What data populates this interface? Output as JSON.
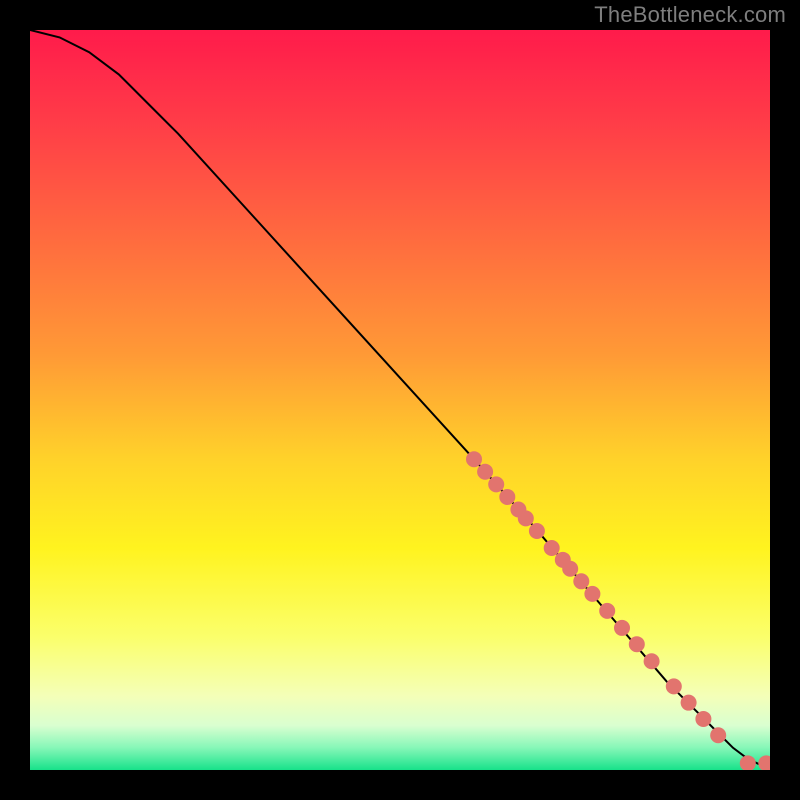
{
  "attribution": "TheBottleneck.com",
  "colors": {
    "background": "#000000",
    "curve": "#000000",
    "dot": "#e2746e",
    "gradient_stops": [
      {
        "offset": 0.0,
        "color": "#ff1b4b"
      },
      {
        "offset": 0.12,
        "color": "#ff3b48"
      },
      {
        "offset": 0.28,
        "color": "#ff6a3f"
      },
      {
        "offset": 0.44,
        "color": "#ff9a36"
      },
      {
        "offset": 0.58,
        "color": "#ffd22a"
      },
      {
        "offset": 0.7,
        "color": "#fff31f"
      },
      {
        "offset": 0.82,
        "color": "#fbff6b"
      },
      {
        "offset": 0.9,
        "color": "#f4ffb8"
      },
      {
        "offset": 0.94,
        "color": "#d9ffd0"
      },
      {
        "offset": 0.97,
        "color": "#86f7b8"
      },
      {
        "offset": 1.0,
        "color": "#18e28a"
      }
    ]
  },
  "chart_data": {
    "type": "line",
    "title": "",
    "xlabel": "",
    "ylabel": "",
    "xlim": [
      0,
      100
    ],
    "ylim": [
      0,
      100
    ],
    "grid": false,
    "legend": false,
    "series": [
      {
        "name": "curve",
        "kind": "line",
        "x": [
          0,
          4,
          8,
          12,
          16,
          20,
          30,
          40,
          50,
          60,
          68,
          74,
          80,
          86,
          90,
          93,
          95,
          97,
          98.5,
          100
        ],
        "y": [
          100,
          99,
          97,
          94,
          90,
          86,
          75,
          64,
          53,
          42,
          33,
          26,
          19,
          12,
          8,
          5,
          3,
          1.5,
          0.8,
          0.8
        ]
      },
      {
        "name": "dots",
        "kind": "scatter",
        "x": [
          60,
          61.5,
          63,
          64.5,
          66,
          67,
          68.5,
          70.5,
          72,
          73,
          74.5,
          76,
          78,
          80,
          82,
          84,
          87,
          89,
          91,
          93,
          97,
          99.5
        ],
        "y": [
          42,
          40.3,
          38.6,
          36.9,
          35.2,
          34,
          32.3,
          30,
          28.4,
          27.2,
          25.5,
          23.8,
          21.5,
          19.2,
          17,
          14.7,
          11.3,
          9.1,
          6.9,
          4.7,
          0.9,
          0.9
        ]
      }
    ]
  }
}
